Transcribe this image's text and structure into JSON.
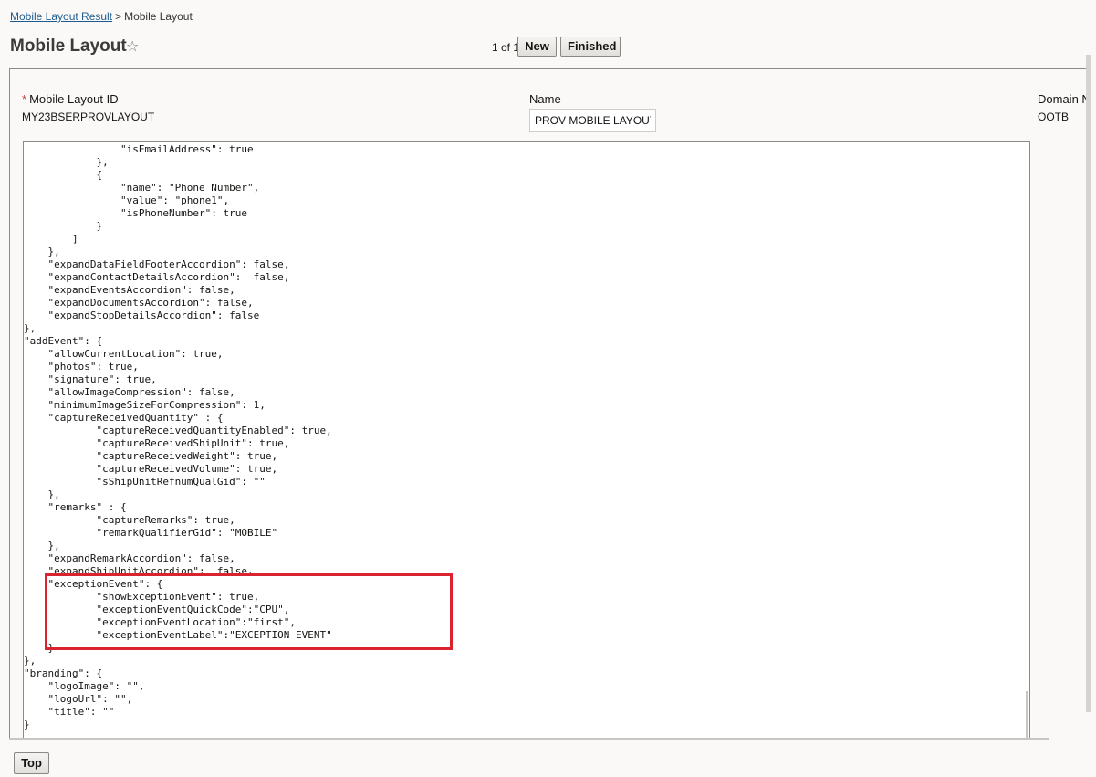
{
  "breadcrumb": {
    "parent": "Mobile Layout Result",
    "separator": ">",
    "current": "Mobile Layout"
  },
  "header": {
    "title": "Mobile Layout",
    "pager": "1 of 1",
    "new_label": "New",
    "finished_label": "Finished"
  },
  "fields": {
    "layout_id_label": "Mobile Layout ID",
    "layout_id_required": "*",
    "layout_id_value": "MY23BSERPROVLAYOUT",
    "name_label": "Name",
    "name_value": "PROV MOBILE LAYOUT",
    "domain_label": "Domain N",
    "domain_value": "OOTB"
  },
  "code": {
    "json_text": "                \"isEmailAddress\": true\n            },\n            {\n                \"name\": \"Phone Number\",\n                \"value\": \"phone1\",\n                \"isPhoneNumber\": true\n            }\n        ]\n    },\n    \"expandDataFieldFooterAccordion\": false,\n    \"expandContactDetailsAccordion\":  false,\n    \"expandEventsAccordion\": false,\n    \"expandDocumentsAccordion\": false,\n    \"expandStopDetailsAccordion\": false\n},\n\"addEvent\": {\n    \"allowCurrentLocation\": true,\n    \"photos\": true,\n    \"signature\": true,\n    \"allowImageCompression\": false,\n    \"minimumImageSizeForCompression\": 1,\n    \"captureReceivedQuantity\" : {\n            \"captureReceivedQuantityEnabled\": true,\n            \"captureReceivedShipUnit\": true,\n            \"captureReceivedWeight\": true,\n            \"captureReceivedVolume\": true,\n            \"sShipUnitRefnumQualGid\": \"\"\n    },\n    \"remarks\" : {\n            \"captureRemarks\": true,\n            \"remarkQualifierGid\": \"MOBILE\"\n    },\n    \"expandRemarkAccordion\": false,\n    \"expandShipUnitAccordion\":  false,\n    \"exceptionEvent\": {\n            \"showExceptionEvent\": true,\n            \"exceptionEventQuickCode\":\"CPU\",\n            \"exceptionEventLocation\":\"first\",\n            \"exceptionEventLabel\":\"EXCEPTION EVENT\"\n    }\n},\n\"branding\": {\n    \"logoImage\": \"\",\n    \"logoUrl\": \"\",\n    \"title\": \"\"\n}\n"
  },
  "footer": {
    "top_label": "Top"
  },
  "colors": {
    "highlight": "#d9232f",
    "link": "#1d5b8e",
    "required": "#c74634"
  }
}
